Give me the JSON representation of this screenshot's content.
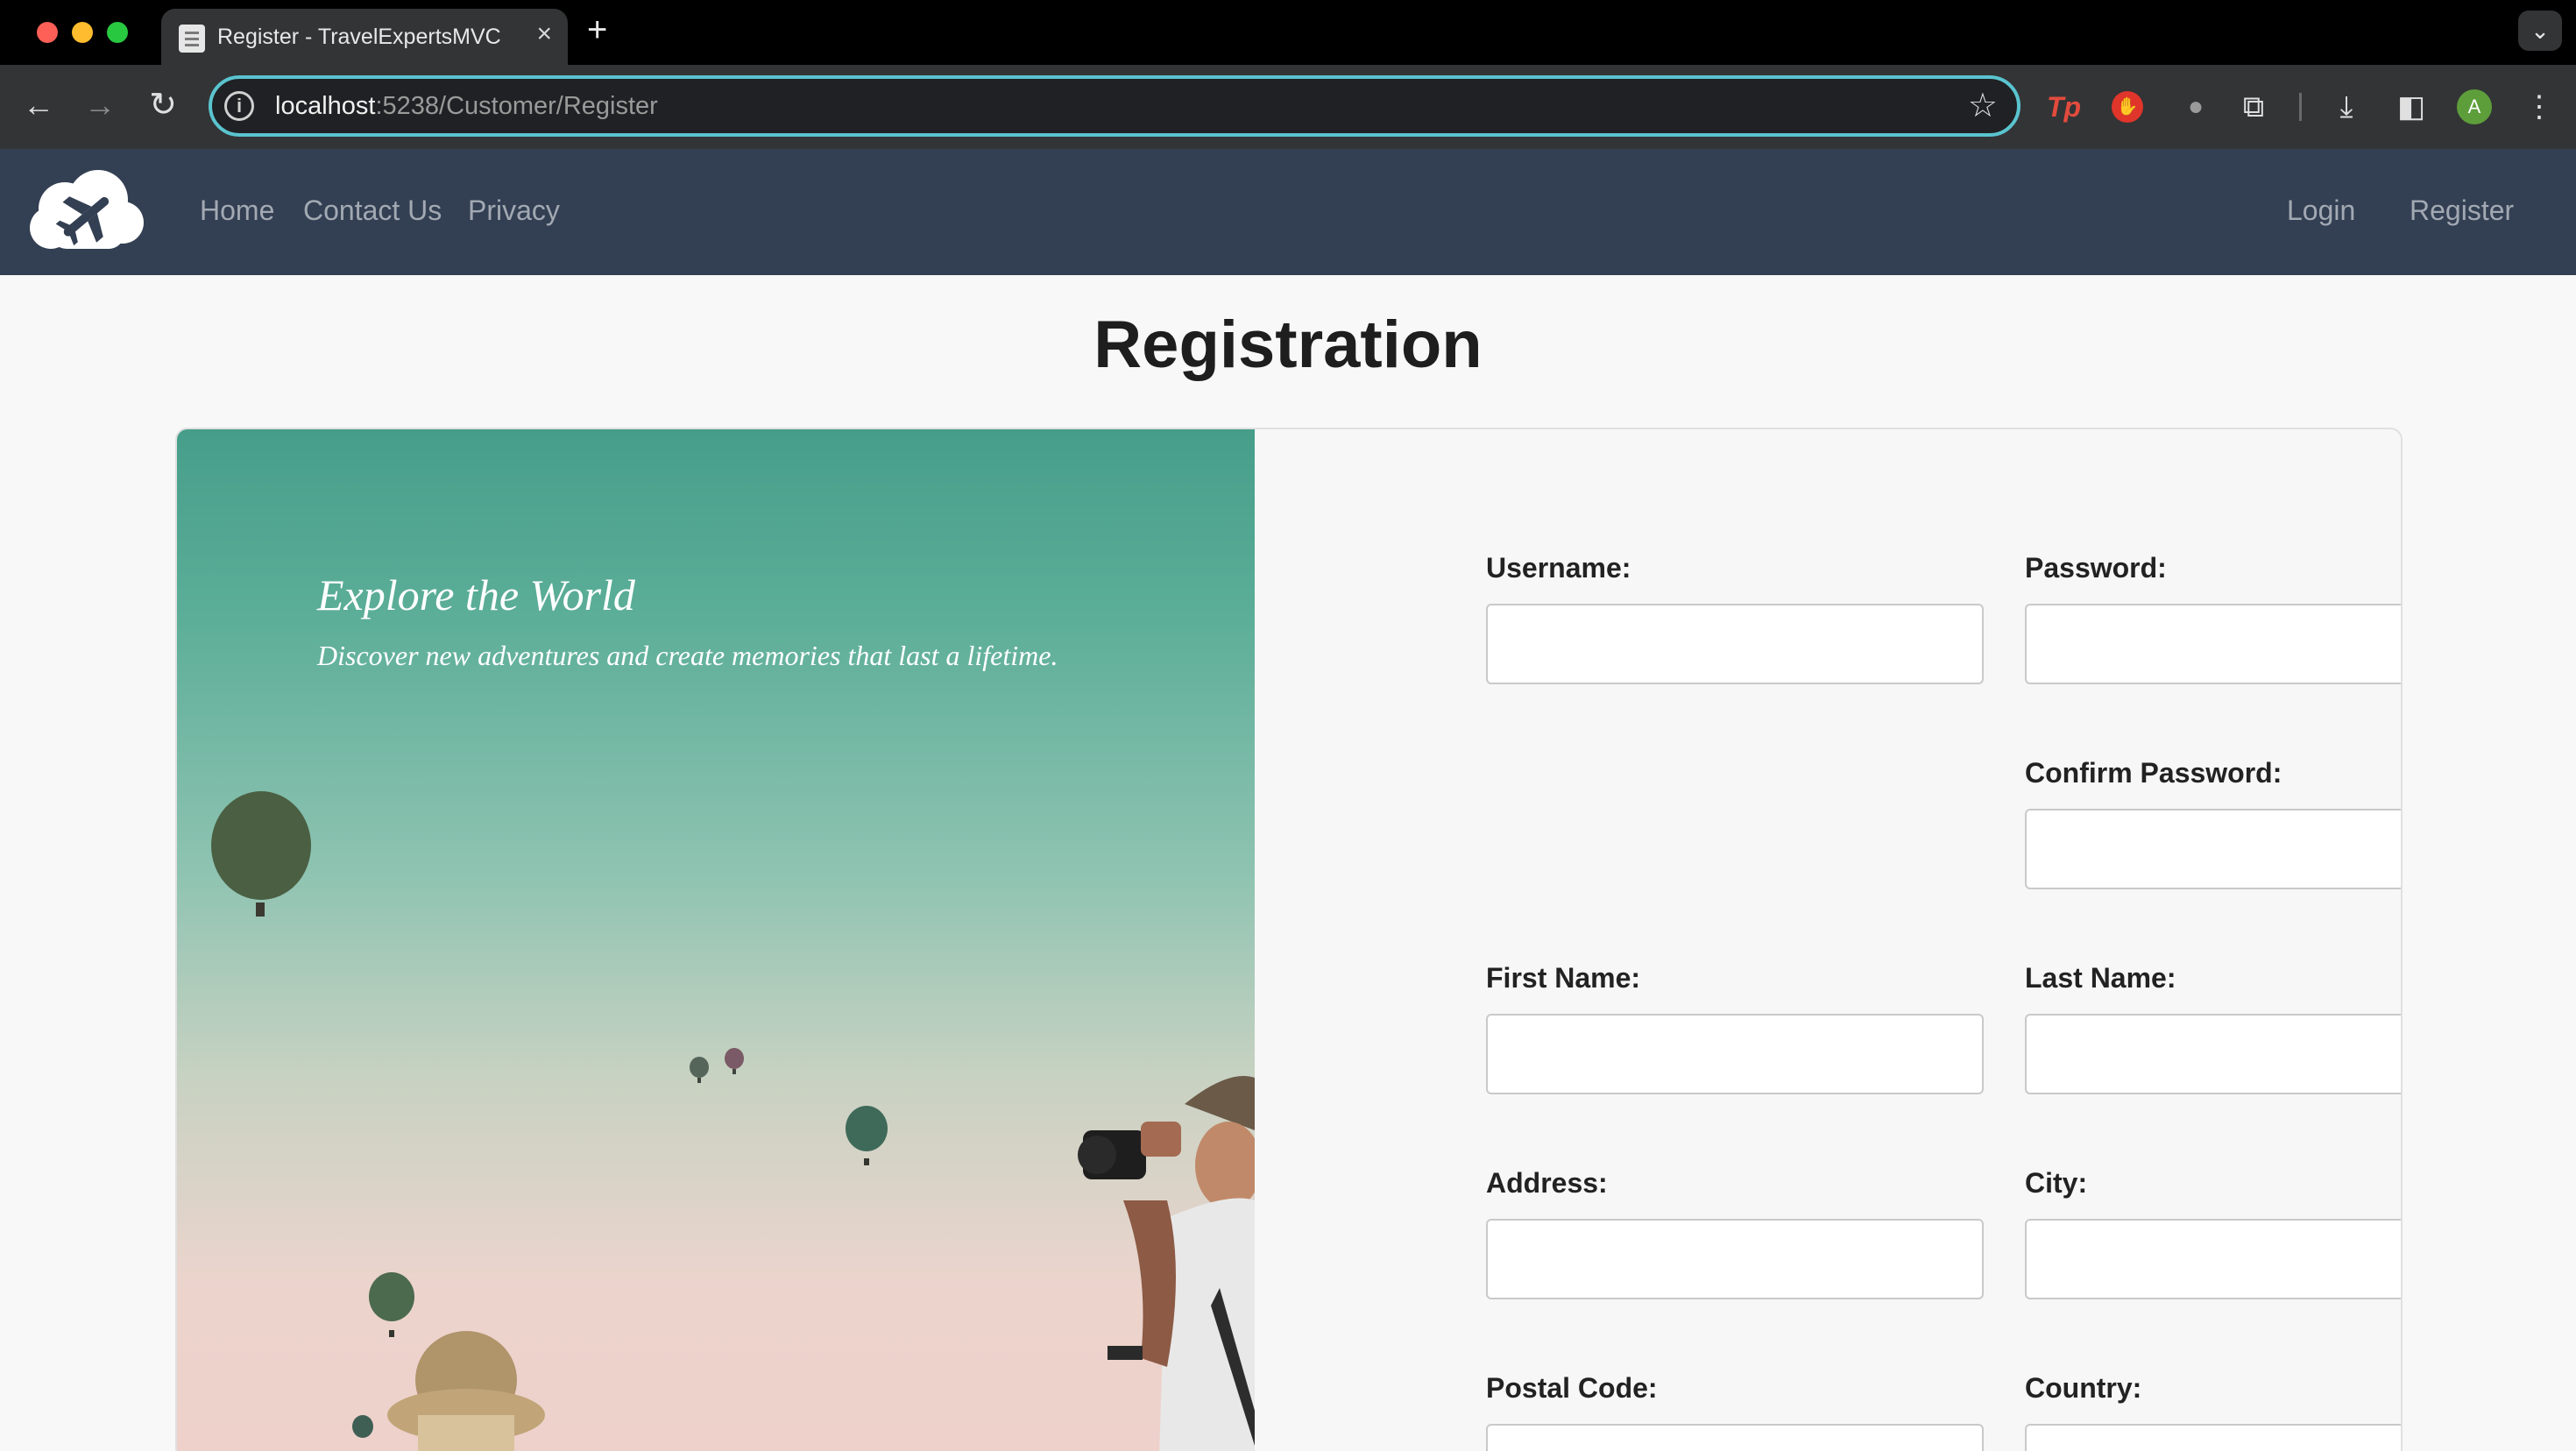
{
  "browser": {
    "tab_title": "Register - TravelExpertsMVC",
    "tab_close_icon": "×",
    "new_tab_icon": "+",
    "tab_menu_icon": "⌄",
    "url_host": "localhost",
    "url_rest": ":5238/Customer/Register",
    "back_icon": "←",
    "forward_icon": "→",
    "reload_icon": "↻",
    "site_info_icon": "i",
    "bookmark_icon": "☆",
    "ext_tp_label": "Tp",
    "ext_stop_icon": "✋",
    "ext_mic_icon": "●",
    "ext_puzzle_icon": "⧉",
    "download_icon": "⤓",
    "sidepanel_icon": "◧",
    "avatar_letter": "A",
    "menu_icon": "⋮"
  },
  "site_nav": {
    "links_left": [
      "Home",
      "Contact Us",
      "Privacy"
    ],
    "links_right": [
      "Login",
      "Register"
    ]
  },
  "page": {
    "title": "Registration"
  },
  "hero": {
    "title": "Explore the World",
    "subtitle": "Discover new adventures and create memories that last a lifetime."
  },
  "form": {
    "username_label": "Username:",
    "password_label": "Password:",
    "confirm_password_label": "Confirm Password:",
    "first_name_label": "First Name:",
    "last_name_label": "Last Name:",
    "address_label": "Address:",
    "city_label": "City:",
    "postal_code_label": "Postal Code:",
    "country_label": "Country:"
  },
  "colors": {
    "nav_bg": "#333f52",
    "nav_link": "#a2a9b3",
    "omnibox_focus": "#5ac4cf",
    "hero_teal": "#469e8a",
    "hero_pink": "#eed0ca"
  }
}
